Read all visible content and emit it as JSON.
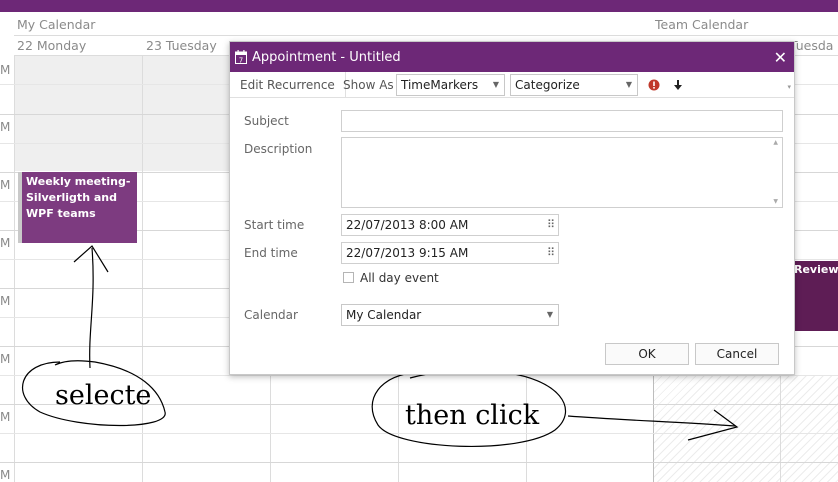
{
  "calendar": {
    "groups": [
      {
        "name": "My Calendar"
      },
      {
        "name": "Team Calendar"
      }
    ],
    "days": [
      {
        "label": "22 Monday"
      },
      {
        "label": "23 Tuesday"
      },
      {
        "label": "Tuesda"
      }
    ],
    "time_marker": "M",
    "appointments": [
      {
        "title": "Weekly meeting- Silverligth and WPF teams"
      },
      {
        "title": "Review m"
      }
    ]
  },
  "dialog": {
    "title": "Appointment - Untitled",
    "toolbar": {
      "edit_recurrence": "Edit Recurrence",
      "show_as_label": "Show As",
      "time_markers": "TimeMarkers",
      "categorize": "Categorize",
      "importance_icon": "exclamation-icon",
      "low_importance_icon": "down-arrow-icon"
    },
    "fields": {
      "subject_label": "Subject",
      "subject_value": "",
      "description_label": "Description",
      "description_value": "",
      "start_label": "Start time",
      "start_value": "22/07/2013 8:00 AM",
      "end_label": "End time",
      "end_value": "22/07/2013 9:15 AM",
      "all_day_label": "All day event",
      "all_day_checked": false,
      "calendar_label": "Calendar",
      "calendar_value": "My Calendar"
    },
    "buttons": {
      "ok": "OK",
      "cancel": "Cancel"
    }
  },
  "annotations": {
    "selected_text": "selecte",
    "click_text": "then click"
  },
  "colors": {
    "accent": "#6d2877",
    "appointment": "#7d3b80",
    "appointment_dark": "#5e1d55"
  }
}
